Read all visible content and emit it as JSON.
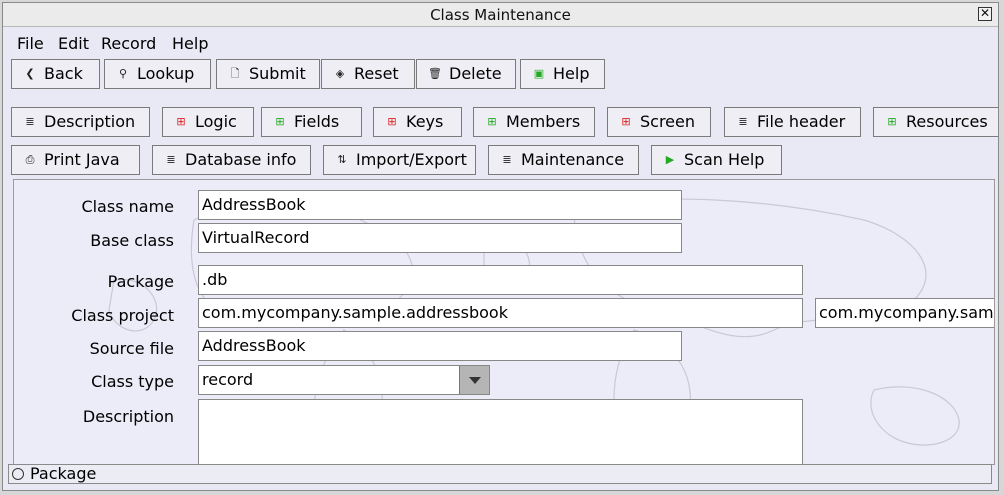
{
  "window": {
    "title": "Class Maintenance",
    "close_glyph": "✕"
  },
  "menu": [
    "File",
    "Edit",
    "Record",
    "Help"
  ],
  "toolbar": {
    "back": "Back",
    "lookup": "Lookup",
    "submit": "Submit",
    "reset": "Reset",
    "delete": "Delete",
    "help": "Help"
  },
  "tabs_row1": [
    "Description",
    "Logic",
    "Fields",
    "Keys",
    "Members",
    "Screen",
    "File header",
    "Resources"
  ],
  "tabs_row2": [
    "Print Java",
    "Database info",
    "Import/Export",
    "Maintenance",
    "Scan Help"
  ],
  "form": {
    "class_name_label": "Class name",
    "class_name_value": "AddressBook",
    "base_class_label": "Base class",
    "base_class_value": "VirtualRecord",
    "package_label": "Package",
    "package_value": ".db",
    "class_project_label": "Class project",
    "class_project_value": "com.mycompany.sample.addressbook",
    "class_project_extra": "com.mycompany.sample.addressbook",
    "source_file_label": "Source file",
    "source_file_value": "AddressBook",
    "class_type_label": "Class type",
    "class_type_value": "record",
    "description_label": "Description",
    "description_value": ""
  },
  "status": {
    "text": "Package"
  },
  "icons": {
    "back": "chevron-left-icon",
    "lookup": "magnifier-icon",
    "submit": "document-icon",
    "reset": "reset-icon",
    "delete": "trash-icon",
    "help": "help-book-icon"
  }
}
